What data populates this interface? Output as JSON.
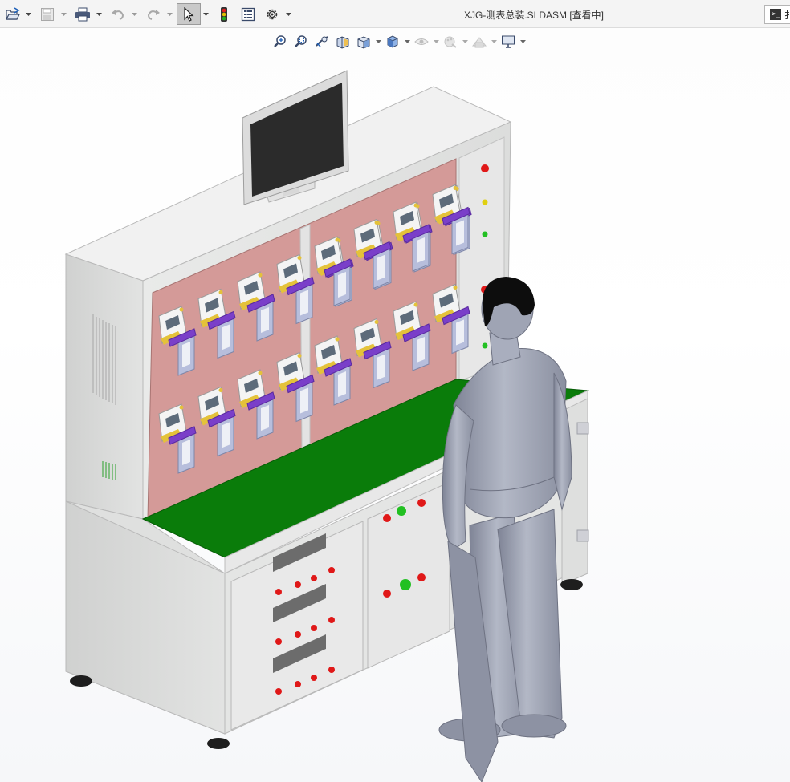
{
  "window": {
    "title": "XJG-测表总装.SLDASM [查看中]"
  },
  "toolbar": {
    "items": [
      {
        "icon": "open-file-icon",
        "label": "Open"
      },
      {
        "icon": "save-icon",
        "label": "Save"
      },
      {
        "icon": "print-icon",
        "label": "Print"
      },
      {
        "icon": "undo-icon",
        "label": "Undo"
      },
      {
        "icon": "redo-icon",
        "label": "Redo"
      },
      {
        "icon": "select-pointer-icon",
        "label": "Select"
      },
      {
        "icon": "traffic-light-icon",
        "label": "Rebuild"
      },
      {
        "icon": "file-properties-icon",
        "label": "File Properties"
      },
      {
        "icon": "gear-icon",
        "label": "Options"
      }
    ],
    "search_prefix": "扌"
  },
  "heads_up_toolbar": {
    "items": [
      {
        "icon": "zoom-to-fit-icon"
      },
      {
        "icon": "zoom-to-area-icon"
      },
      {
        "icon": "previous-view-icon"
      },
      {
        "icon": "section-view-icon"
      },
      {
        "icon": "view-orientation-icon"
      },
      {
        "icon": "display-style-icon"
      },
      {
        "icon": "hide-show-items-icon"
      },
      {
        "icon": "edit-appearance-icon"
      },
      {
        "icon": "apply-scene-icon"
      },
      {
        "icon": "view-settings-icon"
      }
    ]
  },
  "scene": {
    "description_model": "meter test bench assembly with operator mannequin",
    "colors": {
      "cabinet": "#e6e7e6",
      "panel": "#d49a98",
      "bench_top": "#0a7c0a",
      "monitor_screen": "#2b2b2b",
      "meter_clamp": "#7a3fc9",
      "meter_base": "#e4c23a",
      "ct_frame": "#b7bedc",
      "mannequin": "#9ba0b0",
      "lamp_red": "#e01818",
      "lamp_green": "#22c022",
      "lamp_yellow": "#e0d010"
    }
  }
}
